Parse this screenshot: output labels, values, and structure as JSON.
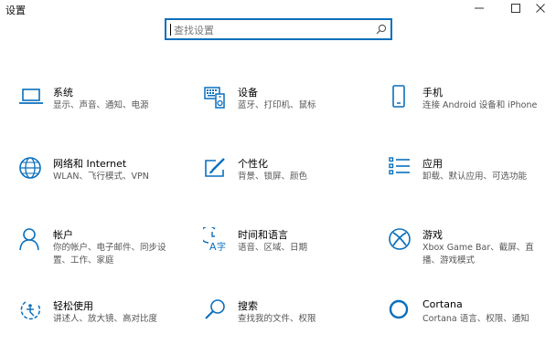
{
  "window": {
    "title": "设置"
  },
  "search": {
    "placeholder": "查找设置"
  },
  "tiles": [
    {
      "title": "系统",
      "desc": "显示、声音、通知、电源",
      "icon": "laptop-icon"
    },
    {
      "title": "设备",
      "desc": "蓝牙、打印机、鼠标",
      "icon": "devices-icon"
    },
    {
      "title": "手机",
      "desc": "连接 Android 设备和 iPhone",
      "icon": "phone-icon"
    },
    {
      "title": "网络和 Internet",
      "desc": "WLAN、飞行模式、VPN",
      "icon": "globe-icon"
    },
    {
      "title": "个性化",
      "desc": "背景、锁屏、颜色",
      "icon": "paint-icon"
    },
    {
      "title": "应用",
      "desc": "卸载、默认应用、可选功能",
      "icon": "apps-list-icon"
    },
    {
      "title": "帐户",
      "desc": "你的帐户、电子邮件、同步设置、工作、家庭",
      "icon": "person-icon"
    },
    {
      "title": "时间和语言",
      "desc": "语音、区域、日期",
      "icon": "time-language-icon"
    },
    {
      "title": "游戏",
      "desc": "Xbox Game Bar、截屏、直播、游戏模式",
      "icon": "xbox-icon"
    },
    {
      "title": "轻松使用",
      "desc": "讲述人、放大镜、高对比度",
      "icon": "ease-of-access-icon"
    },
    {
      "title": "搜索",
      "desc": "查找我的文件、权限",
      "icon": "search-icon"
    },
    {
      "title": "Cortana",
      "desc": "Cortana 语言、权限、通知",
      "icon": "cortana-icon"
    }
  ],
  "colors": {
    "accent": "#0a6fbd",
    "desc_text": "#555555"
  }
}
